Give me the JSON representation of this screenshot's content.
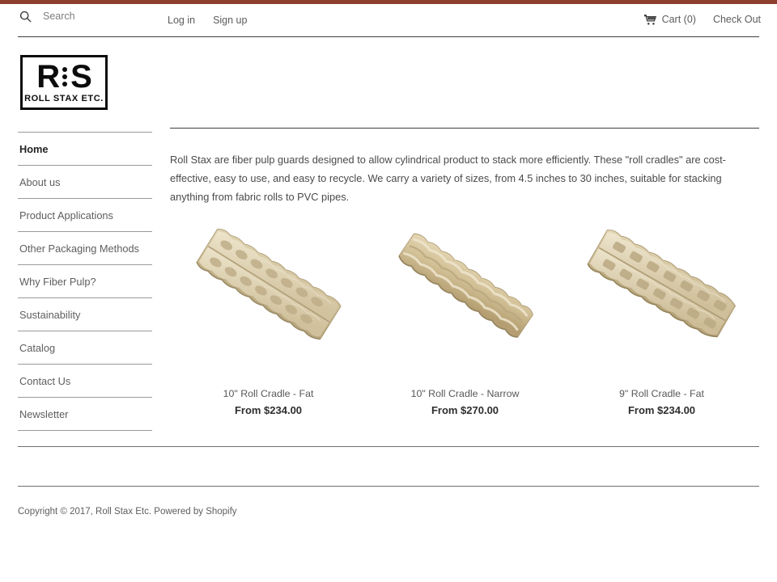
{
  "colors": {
    "top_strip": "#8c3f2c",
    "rule": "#3f3f3f",
    "text_muted": "#5e5e5e",
    "text_dark": "#232323",
    "product_pulp": "#cfc09a"
  },
  "header": {
    "search": {
      "icon": "search-icon",
      "placeholder": "Search",
      "value": ""
    },
    "auth": [
      {
        "label": "Log in"
      },
      {
        "label": "Sign up"
      }
    ],
    "cart": {
      "icon": "shopping-cart-icon",
      "label": "Cart (0)",
      "count": 0
    },
    "checkout": {
      "label": "Check Out"
    }
  },
  "logo": {
    "letter_left": "R",
    "letter_right": "S",
    "wordmark": "ROLL STAX ETC.",
    "dot_count": 3
  },
  "sidebar": {
    "items": [
      {
        "label": "Home",
        "active": true
      },
      {
        "label": "About us",
        "active": false
      },
      {
        "label": "Product Applications",
        "active": false
      },
      {
        "label": "Other Packaging Methods",
        "active": false
      },
      {
        "label": "Why Fiber Pulp?",
        "active": false
      },
      {
        "label": "Sustainability",
        "active": false
      },
      {
        "label": "Catalog",
        "active": false
      },
      {
        "label": "Contact Us",
        "active": false
      },
      {
        "label": "Newsletter",
        "active": false
      }
    ]
  },
  "main": {
    "intro": "Roll Stax are fiber pulp guards designed to allow cylindrical product to stack more efficiently. These \"roll cradles\" are cost-effective, easy to use, and easy to recycle.  We carry a variety of sizes, from 4.5 inches to 30 inches, suitable for stacking anything from fabric rolls to PVC pipes."
  },
  "products": [
    {
      "title": "10\" Roll Cradle - Fat",
      "price": "From $234.00",
      "image_alt": "10 inch fat fiber pulp roll cradle"
    },
    {
      "title": "10\" Roll Cradle - Narrow",
      "price": "From $270.00",
      "image_alt": "10 inch narrow fiber pulp roll cradle"
    },
    {
      "title": "9\" Roll Cradle - Fat",
      "price": "From $234.00",
      "image_alt": "9 inch fat fiber pulp roll cradle"
    }
  ],
  "footer": {
    "copyright": "Copyright © 2017, Roll Stax Etc. Powered by Shopify"
  }
}
